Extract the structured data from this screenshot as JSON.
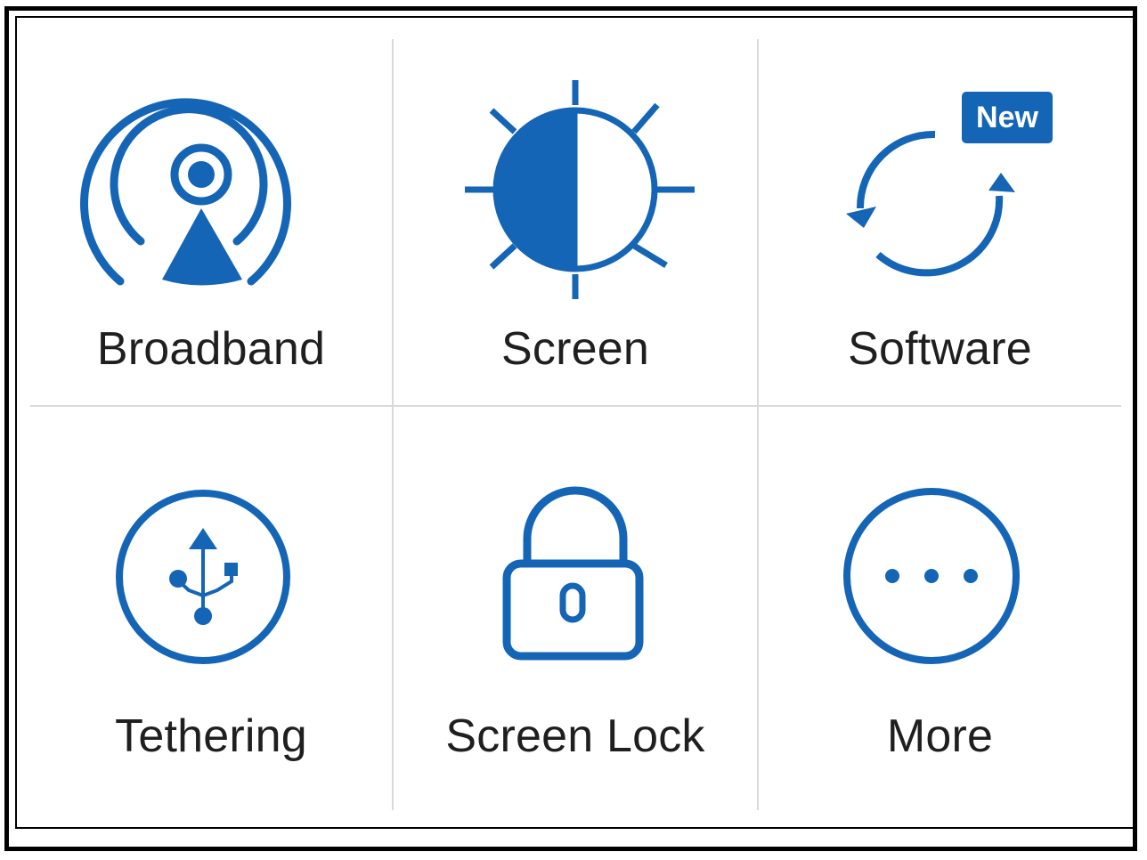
{
  "accent_color": "#1565b6",
  "tiles": [
    {
      "label": "Broadband",
      "icon": "broadcast-antenna-icon"
    },
    {
      "label": "Screen",
      "icon": "brightness-icon"
    },
    {
      "label": "Software",
      "icon": "refresh-sync-icon",
      "badge": "New"
    },
    {
      "label": "Tethering",
      "icon": "usb-icon"
    },
    {
      "label": "Screen Lock",
      "icon": "padlock-icon"
    },
    {
      "label": "More",
      "icon": "more-dots-icon"
    }
  ]
}
